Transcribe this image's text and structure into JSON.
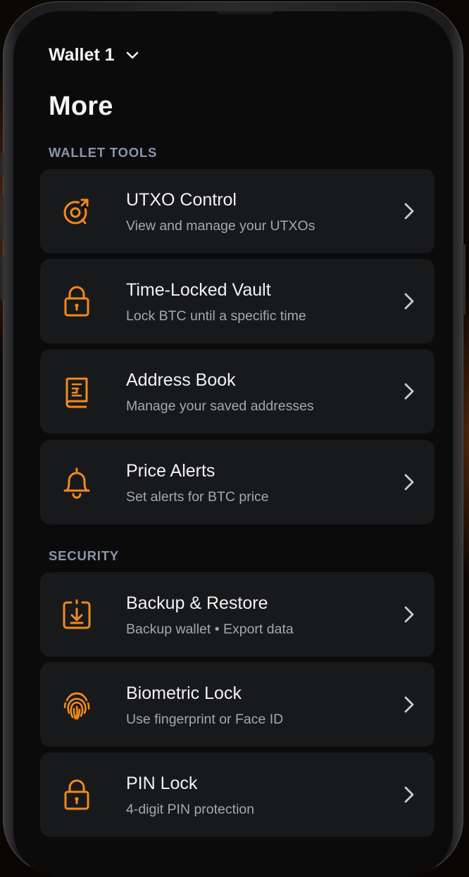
{
  "colors": {
    "accent": "#f28a1c",
    "card_bg": "#18191b",
    "screen_bg": "#0b0b0c",
    "section_label": "#8a96a8",
    "title_text": "#f2f2f3",
    "subtitle_text": "#a3a8b2"
  },
  "header": {
    "wallet_name": "Wallet 1",
    "wallet_dropdown_icon": "chevron-down-icon",
    "page_title": "More"
  },
  "sections": [
    {
      "label": "WALLET TOOLS",
      "items": [
        {
          "icon": "utxo-coin-icon",
          "title": "UTXO Control",
          "subtitle": "View and manage your UTXOs"
        },
        {
          "icon": "lock-icon",
          "title": "Time-Locked Vault",
          "subtitle": "Lock BTC until a specific time"
        },
        {
          "icon": "address-book-icon",
          "title": "Address Book",
          "subtitle": "Manage your saved addresses"
        },
        {
          "icon": "bell-icon",
          "title": "Price Alerts",
          "subtitle": "Set alerts for BTC price"
        }
      ]
    },
    {
      "label": "SECURITY",
      "items": [
        {
          "icon": "backup-download-icon",
          "title": "Backup & Restore",
          "subtitle": "Backup wallet • Export data"
        },
        {
          "icon": "fingerprint-icon",
          "title": "Biometric Lock",
          "subtitle": "Use fingerprint or Face ID"
        },
        {
          "icon": "lock-icon",
          "title": "PIN Lock",
          "subtitle": "4-digit PIN protection"
        }
      ]
    }
  ]
}
